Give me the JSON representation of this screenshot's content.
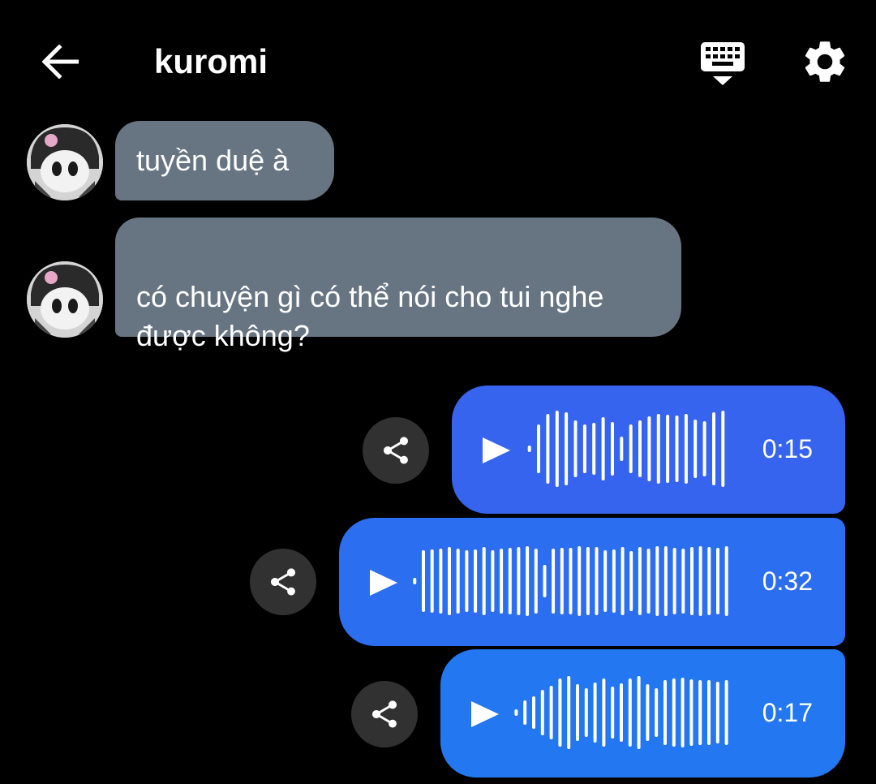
{
  "header": {
    "back_icon": "arrow-left-icon",
    "title": "kuromi",
    "keyboard_icon": "keyboard-hide-icon",
    "settings_icon": "gear-icon"
  },
  "messages_in": [
    {
      "text": "tuyền duệ à"
    },
    {
      "text": "có chuyện gì có thể nói cho tui nghe\nđược không?"
    }
  ],
  "voice_messages": [
    {
      "duration": "0:15",
      "color": "#3764ee",
      "share_icon": "share-icon",
      "play_icon": "play-icon"
    },
    {
      "duration": "0:32",
      "color": "#2c6ef0",
      "share_icon": "share-icon",
      "play_icon": "play-icon"
    },
    {
      "duration": "0:17",
      "color": "#2377f0",
      "share_icon": "share-icon",
      "play_icon": "play-icon"
    }
  ],
  "colors": {
    "background": "#000000",
    "incoming_bubble": "#677583",
    "share_button": "#313131"
  }
}
